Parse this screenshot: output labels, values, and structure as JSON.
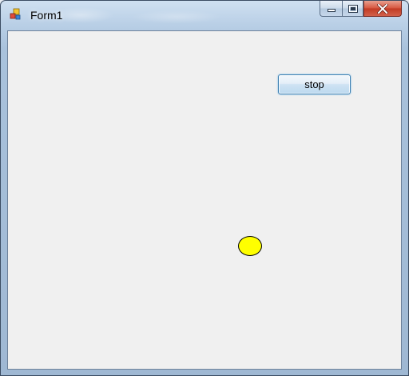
{
  "window": {
    "title": "Form1",
    "icon": "winforms-app-icon",
    "caption_buttons": [
      "minimize-icon",
      "restore-icon",
      "close-icon"
    ]
  },
  "form": {
    "stop_label": "stop",
    "ball_color": "#ffff00"
  },
  "colors": {
    "form_background": "#f0f0f0",
    "close_button": "#c8452e"
  }
}
